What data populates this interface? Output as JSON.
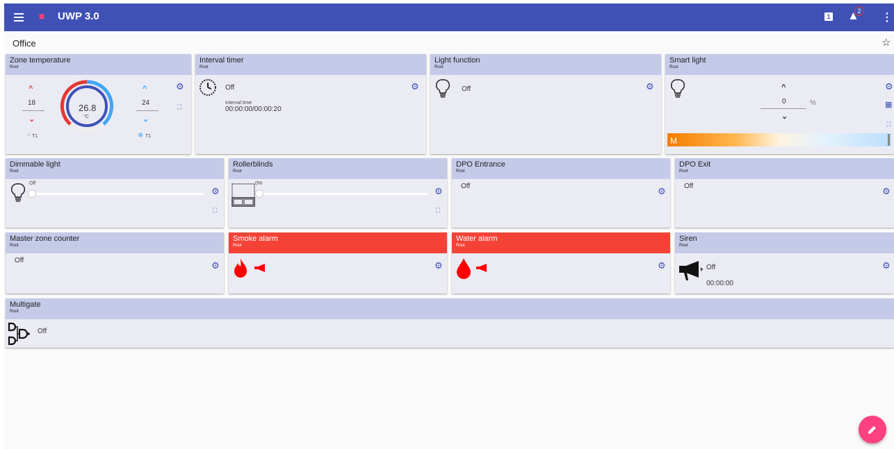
{
  "appbar": {
    "title": "UWP 3.0",
    "notification_count": "1",
    "warning_count": "2"
  },
  "page": {
    "title": "Office"
  },
  "cards": {
    "zone_temperature": {
      "title": "Zone temperature",
      "subtitle": "Root",
      "heat_setpoint": "18",
      "cool_setpoint": "24",
      "current": "26.8",
      "unit": "°C",
      "heat_label": "T1",
      "cool_label": "T1"
    },
    "interval_timer": {
      "title": "Interval timer",
      "subtitle": "Root",
      "state": "Off",
      "interval_label": "Interval time",
      "interval_value": "00:00:00/00:00:20"
    },
    "light_function": {
      "title": "Light function",
      "subtitle": "Root",
      "state": "Off"
    },
    "smart_light": {
      "title": "Smart light",
      "subtitle": "Root",
      "value": "0",
      "unit": "%",
      "mode": "M"
    },
    "dimmable_light": {
      "title": "Dimmable light",
      "subtitle": "Root",
      "state": "Off",
      "level": 0
    },
    "rollerblinds": {
      "title": "Rollerblinds",
      "subtitle": "Root",
      "position": "0%",
      "level": 0
    },
    "dpo_entrance": {
      "title": "DPO Entrance",
      "subtitle": "Root",
      "state": "Off"
    },
    "dpo_exit": {
      "title": "DPO Exit",
      "subtitle": "Root",
      "state": "Off"
    },
    "master_zone_counter": {
      "title": "Master zone counter",
      "subtitle": "Root",
      "state": "Off"
    },
    "smoke_alarm": {
      "title": "Smoke alarm",
      "subtitle": "Root"
    },
    "water_alarm": {
      "title": "Water alarm",
      "subtitle": "Root"
    },
    "siren": {
      "title": "Siren",
      "subtitle": "Root",
      "state": "Off",
      "time": "00:00:00"
    },
    "multigate": {
      "title": "Multigate",
      "subtitle": "Root",
      "state": "Off"
    }
  },
  "colors": {
    "appbar": "#3f51b5",
    "card_header": "#c5cae9",
    "alarm_header": "#f44336",
    "accent": "#ff4081",
    "icon": "#3f51b5"
  },
  "icons": [
    "menu-icon",
    "home-icon",
    "notification-icon",
    "warning-icon",
    "more-vert-icon",
    "star-icon",
    "gear-icon",
    "fullscreen-icon",
    "calendar-icon",
    "bulb-icon",
    "clock-icon",
    "fire-icon",
    "water-drop-icon",
    "megaphone-icon",
    "logic-gate-icon",
    "edit-icon"
  ]
}
